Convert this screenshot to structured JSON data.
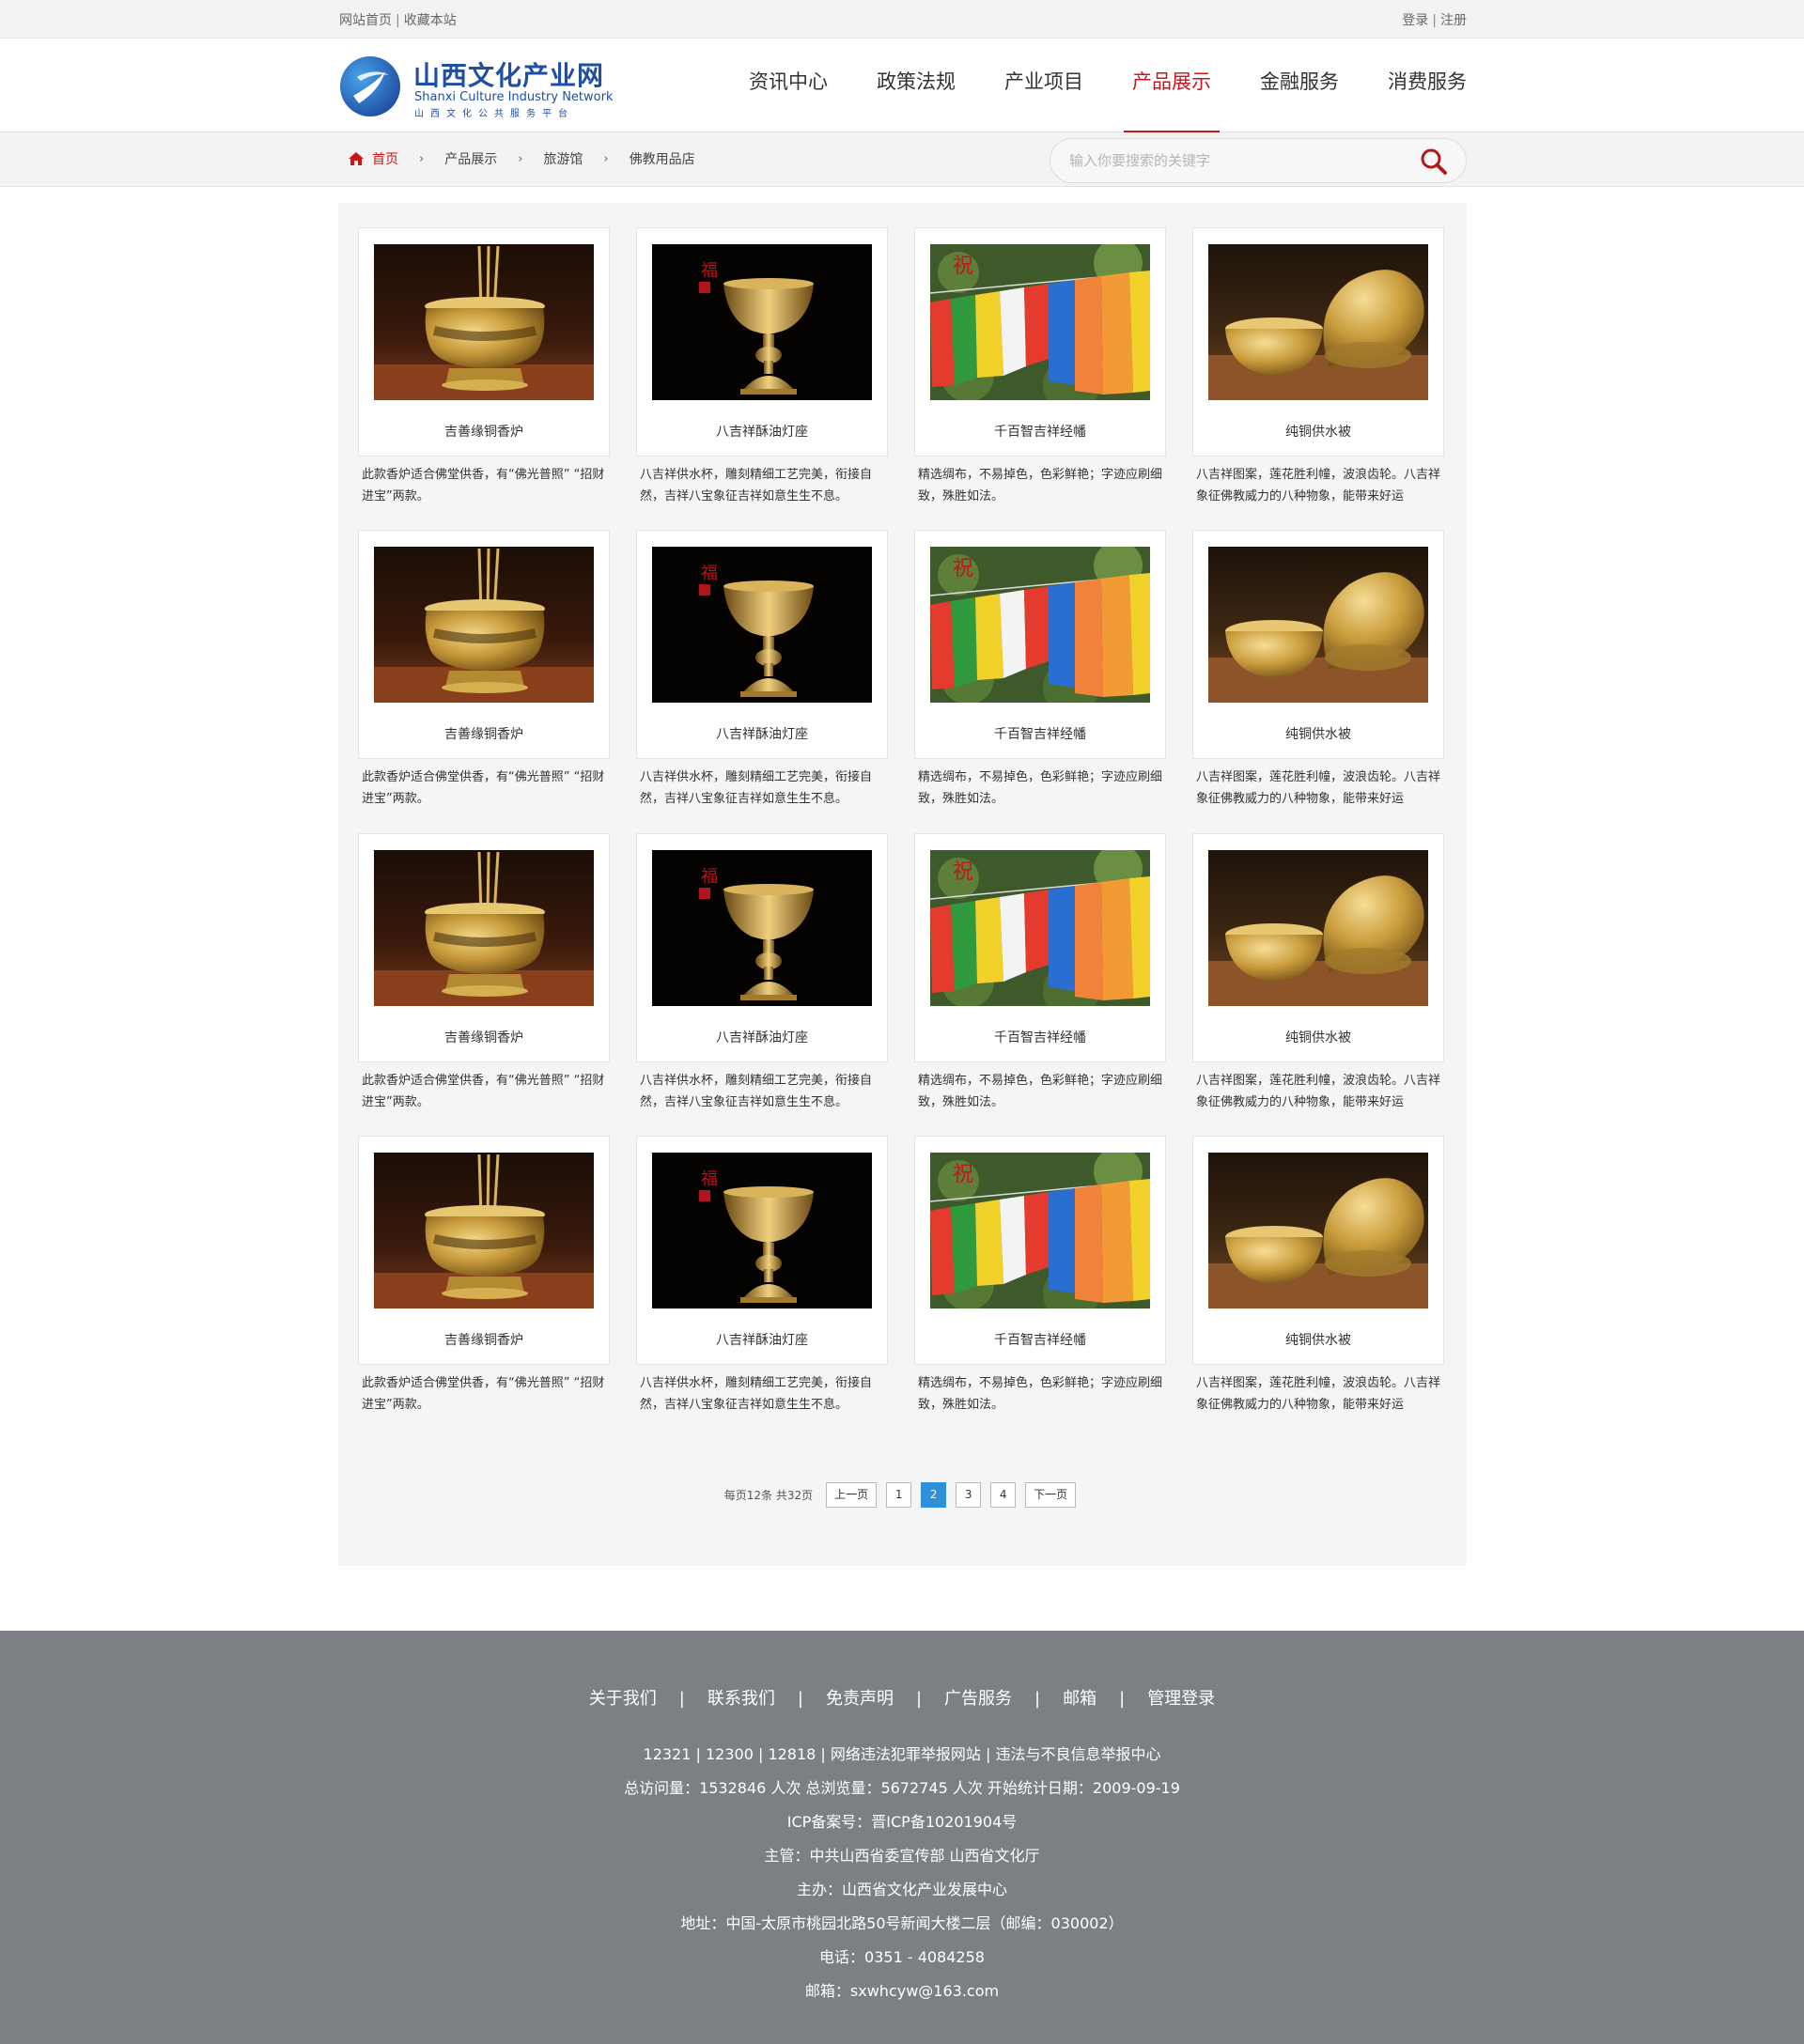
{
  "topbar": {
    "home_link": "网站首页",
    "bookmark_link": "收藏本站",
    "login": "登录",
    "register": "注册",
    "separator": "|"
  },
  "logo": {
    "name_cn": "山西文化产业网",
    "name_en": "Shanxi Culture Industry Network",
    "subtitle": "山西文化公共服务平台",
    "colors": {
      "blue": "#1f4fa3",
      "light_blue": "#3a8fd8"
    }
  },
  "nav": {
    "items": [
      {
        "label": "资讯中心"
      },
      {
        "label": "政策法规"
      },
      {
        "label": "产业项目"
      },
      {
        "label": "产品展示"
      },
      {
        "label": "金融服务"
      },
      {
        "label": "消费服务"
      }
    ],
    "active_color": "#c8161d"
  },
  "breadcrumb": {
    "home_icon": "home-icon",
    "home": "首页",
    "items": [
      "产品展示",
      "旅游馆",
      "佛教用品店"
    ],
    "separator": "›"
  },
  "search": {
    "placeholder": "输入你要搜索的关键字",
    "icon": "search-icon"
  },
  "products": [
    {
      "title": "吉善缘铜香炉",
      "desc": "此款香炉适合佛堂供香，有“佛光普照” “招财进宝”两款。",
      "image": "incense-burner"
    },
    {
      "title": "八吉祥酥油灯座",
      "desc": "八吉祥供水杯，雕刻精细工艺完美，衔接自然，吉祥八宝象征吉祥如意生生不息。",
      "image": "butter-lamp"
    },
    {
      "title": "千百智吉祥经幡",
      "desc": "精选绸布，不易掉色，色彩鲜艳；字迹应刷细致，殊胜如法。",
      "image": "prayer-flags"
    },
    {
      "title": "纯铜供水被",
      "desc": "八吉祥图案，莲花胜利幢，波浪齿轮。八吉祥象征佛教威力的八种物象，能带来好运",
      "image": "water-bowls"
    },
    {
      "title": "吉善缘铜香炉",
      "desc": "此款香炉适合佛堂供香，有“佛光普照” “招财进宝”两款。",
      "image": "incense-burner"
    },
    {
      "title": "八吉祥酥油灯座",
      "desc": "八吉祥供水杯，雕刻精细工艺完美，衔接自然，吉祥八宝象征吉祥如意生生不息。",
      "image": "butter-lamp"
    },
    {
      "title": "千百智吉祥经幡",
      "desc": "精选绸布，不易掉色，色彩鲜艳；字迹应刷细致，殊胜如法。",
      "image": "prayer-flags"
    },
    {
      "title": "纯铜供水被",
      "desc": "八吉祥图案，莲花胜利幢，波浪齿轮。八吉祥象征佛教威力的八种物象，能带来好运",
      "image": "water-bowls"
    },
    {
      "title": "吉善缘铜香炉",
      "desc": "此款香炉适合佛堂供香，有“佛光普照” “招财进宝”两款。",
      "image": "incense-burner"
    },
    {
      "title": "八吉祥酥油灯座",
      "desc": "八吉祥供水杯，雕刻精细工艺完美，衔接自然，吉祥八宝象征吉祥如意生生不息。",
      "image": "butter-lamp"
    },
    {
      "title": "千百智吉祥经幡",
      "desc": "精选绸布，不易掉色，色彩鲜艳；字迹应刷细致，殊胜如法。",
      "image": "prayer-flags"
    },
    {
      "title": "纯铜供水被",
      "desc": "八吉祥图案，莲花胜利幢，波浪齿轮。八吉祥象征佛教威力的八种物象，能带来好运",
      "image": "water-bowls"
    },
    {
      "title": "吉善缘铜香炉",
      "desc": "此款香炉适合佛堂供香，有“佛光普照” “招财进宝”两款。",
      "image": "incense-burner"
    },
    {
      "title": "八吉祥酥油灯座",
      "desc": "八吉祥供水杯，雕刻精细工艺完美，衔接自然，吉祥八宝象征吉祥如意生生不息。",
      "image": "butter-lamp"
    },
    {
      "title": "千百智吉祥经幡",
      "desc": "精选绸布，不易掉色，色彩鲜艳；字迹应刷细致，殊胜如法。",
      "image": "prayer-flags"
    },
    {
      "title": "纯铜供水被",
      "desc": "八吉祥图案，莲花胜利幢，波浪齿轮。八吉祥象征佛教威力的八种物象，能带来好运",
      "image": "water-bowls"
    }
  ],
  "pagination": {
    "info": "每页12条 共32页",
    "prev": "上一页",
    "next": "下一页",
    "pages": [
      "1",
      "2",
      "3",
      "4"
    ],
    "current": "2",
    "current_color": "#2f8fd8"
  },
  "footer": {
    "links": [
      "关于我们",
      "联系我们",
      "免责声明",
      "广告服务",
      "邮箱",
      "管理登录"
    ],
    "separator": "|",
    "lines": [
      "12321 | 12300 | 12818 | 网络违法犯罪举报网站 | 违法与不良信息举报中心",
      "总访问量：1532846 人次  总浏览量：5672745 人次  开始统计日期：2009-09-19",
      "ICP备案号：晋ICP备10201904号",
      "主管：中共山西省委宣传部 山西省文化厅",
      "主办：山西省文化产业发展中心",
      "地址：中国-太原市桃园北路50号新闻大楼二层（邮编：030002）",
      "电话：0351 - 4084258",
      "邮箱：sxwhcyw@163.com"
    ],
    "background": "#7c7f83"
  }
}
